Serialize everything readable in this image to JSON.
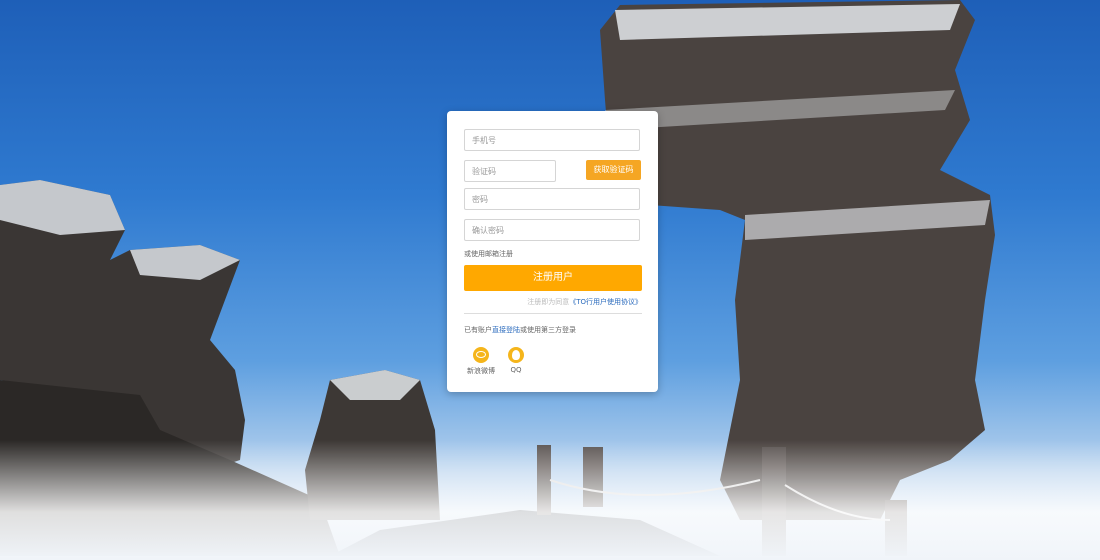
{
  "form": {
    "phone_placeholder": "手机号",
    "code_placeholder": "验证码",
    "get_code_label": "获取验证码",
    "password_placeholder": "密码",
    "confirm_placeholder": "确认密码",
    "email_register_link": "或使用邮箱注册",
    "register_button": "注册用户",
    "agreement_prefix": "注册即为同意",
    "agreement_link": "《TO行用户使用协议》",
    "login_prefix": "已有账户",
    "login_link": "直接登陆",
    "login_suffix": "或使用第三方登录"
  },
  "social": {
    "weibo_label": "新浪微博",
    "qq_label": "QQ"
  },
  "colors": {
    "accent": "#ffa800",
    "link": "#2b6bbd"
  }
}
